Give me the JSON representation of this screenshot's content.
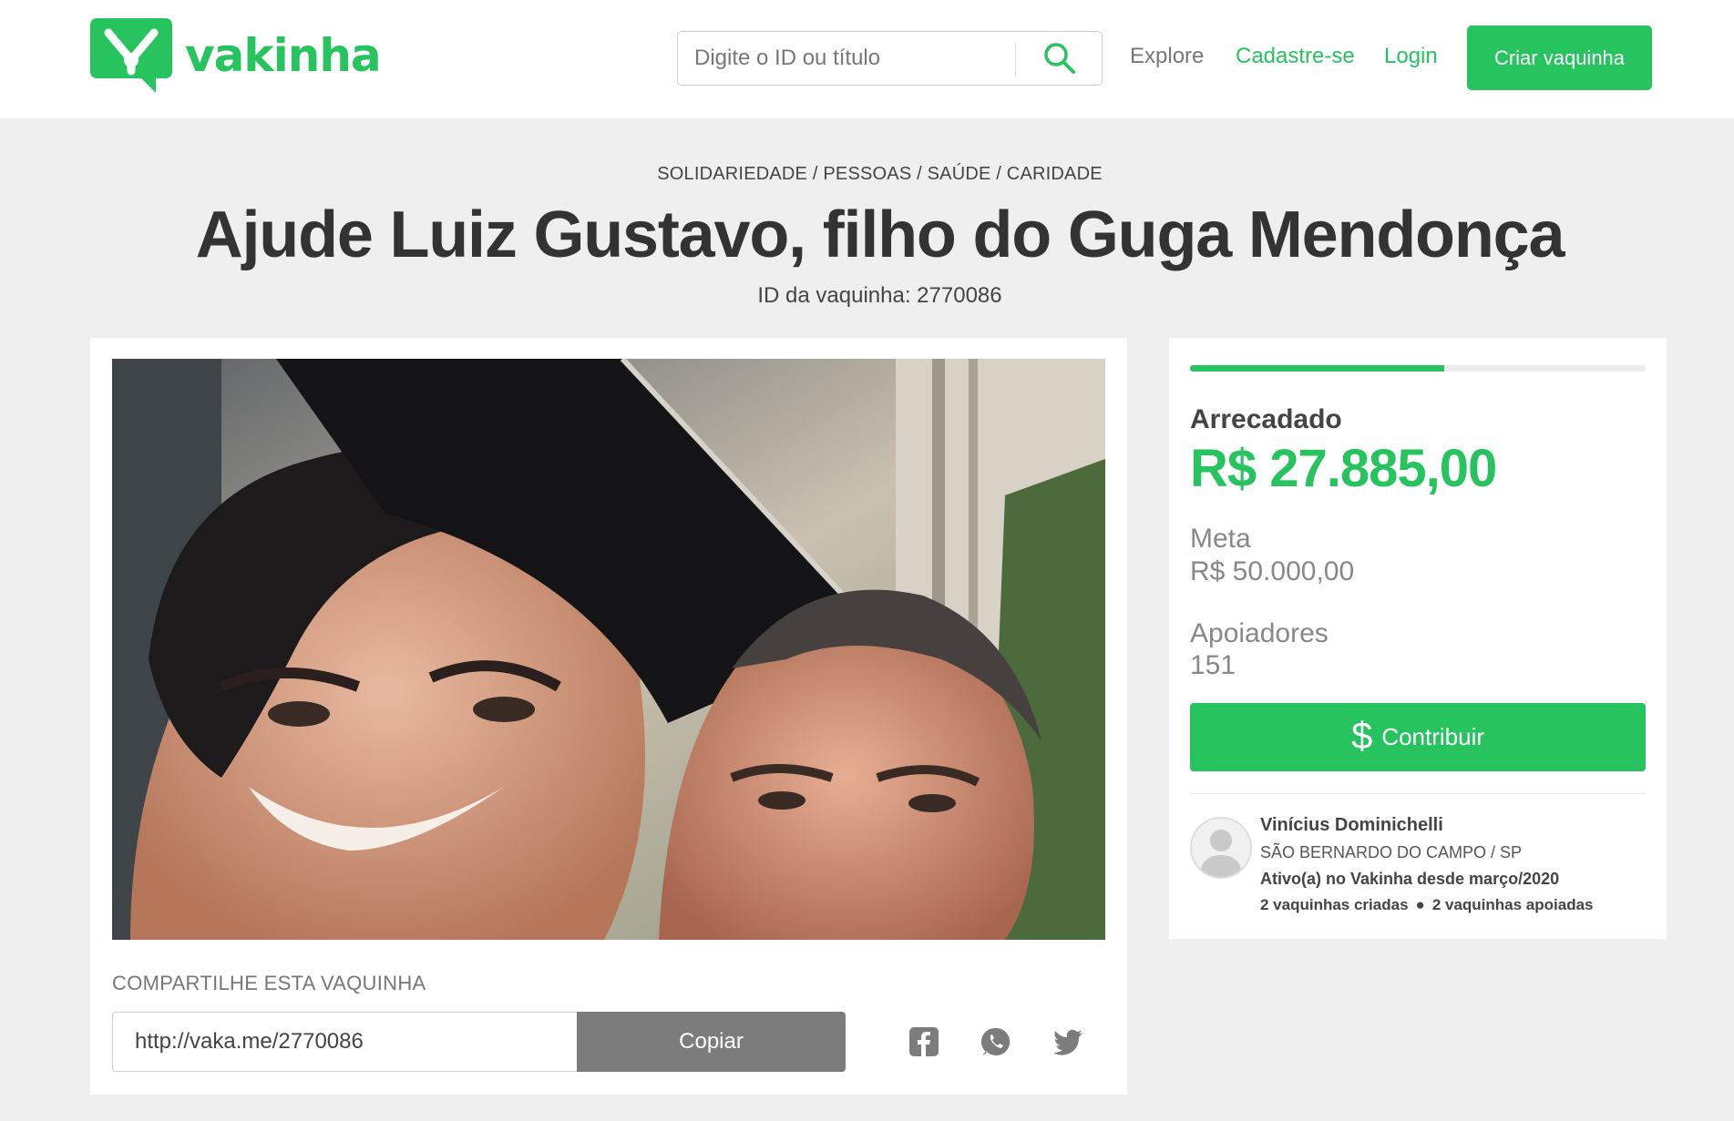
{
  "brand": {
    "name": "vakinha",
    "accent": "#26c35f"
  },
  "header": {
    "search": {
      "placeholder": "Digite o ID ou título",
      "icon": "search-icon"
    },
    "nav": {
      "explore": "Explore",
      "signup": "Cadastre-se",
      "login": "Login"
    },
    "cta": "Criar vaquinha"
  },
  "campaign": {
    "categories": "SOLIDARIEDADE / PESSOAS / SAÚDE / CARIDADE",
    "title": "Ajude Luiz Gustavo, filho do Guga Mendonça",
    "id_line": "ID da vaquinha: 2770086",
    "photo": "photo of two smiling men, the younger wearing a graduation cap"
  },
  "share": {
    "label": "COMPARTILHE ESTA VAQUINHA",
    "link": "http://vaka.me/2770086",
    "copy_label": "Copiar",
    "networks": [
      "facebook-icon",
      "whatsapp-icon",
      "twitter-icon"
    ]
  },
  "stats": {
    "progress_fraction": 0.5577,
    "raised_label": "Arrecadado",
    "raised_value": "R$ 27.885,00",
    "goal_label": "Meta",
    "goal_value": "R$ 50.000,00",
    "supporters_label": "Apoiadores",
    "supporters_value": "151",
    "contribute_label": "Contribuir",
    "contribute_icon": "dollar-icon"
  },
  "owner": {
    "name": "Vinícius Dominichelli",
    "location": "SÃO BERNARDO DO CAMPO / SP",
    "since": "Ativo(a) no Vakinha desde março/2020",
    "created": "2 vaquinhas criadas",
    "supported": "2 vaquinhas apoiadas"
  }
}
